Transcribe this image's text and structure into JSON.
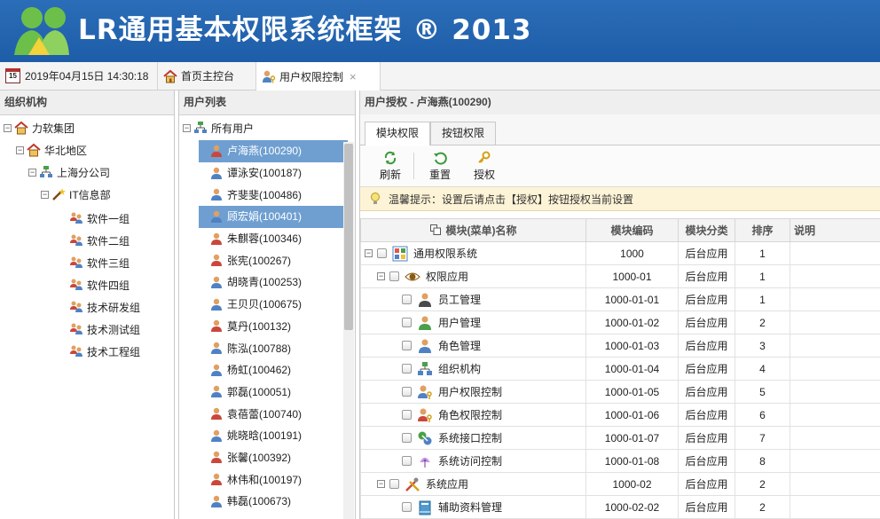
{
  "banner": {
    "title": "LR通用基本权限系统框架 ® 2013"
  },
  "tabbar": {
    "date_label": "2019年04月15日 14:30:18",
    "calendar_day": "15",
    "home_label": "首页主控台",
    "active_label": "用户权限控制",
    "close_glyph": "×"
  },
  "org_panel": {
    "title": "组织机构",
    "nodes": [
      "力软集团",
      "华北地区",
      "上海分公司",
      "IT信息部",
      "软件一组",
      "软件二组",
      "软件三组",
      "软件四组",
      "技术研发组",
      "技术测试组",
      "技术工程组"
    ]
  },
  "user_panel": {
    "title": "用户列表",
    "root": "所有用户",
    "users": [
      "卢海燕(100290)",
      "谭泳安(100187)",
      "齐斐斐(100486)",
      "顾宏娟(100401)",
      "朱麒蓉(100346)",
      "张宪(100267)",
      "胡晓青(100253)",
      "王贝贝(100675)",
      "莫丹(100132)",
      "陈泓(100788)",
      "杨虹(100462)",
      "郭磊(100051)",
      "袁蓓蕾(100740)",
      "姚晓晗(100191)",
      "张馨(100392)",
      "林伟和(100197)",
      "韩磊(100673)"
    ]
  },
  "main_panel": {
    "title": "用户授权 - 卢海燕(100290)",
    "tabs": [
      "模块权限",
      "按钮权限"
    ],
    "toolbar": {
      "refresh": "刷新",
      "reset": "重置",
      "grant": "授权"
    },
    "tip": "温馨提示：设置后请点击【授权】按钮授权当前设置",
    "columns": [
      "模块(菜单)名称",
      "模块编码",
      "模块分类",
      "排序",
      "说明"
    ],
    "rows": [
      {
        "name": "通用权限系统",
        "code": "1000",
        "category": "后台应用",
        "order": "1"
      },
      {
        "name": "权限应用",
        "code": "1000-01",
        "category": "后台应用",
        "order": "1"
      },
      {
        "name": "员工管理",
        "code": "1000-01-01",
        "category": "后台应用",
        "order": "1"
      },
      {
        "name": "用户管理",
        "code": "1000-01-02",
        "category": "后台应用",
        "order": "2"
      },
      {
        "name": "角色管理",
        "code": "1000-01-03",
        "category": "后台应用",
        "order": "3"
      },
      {
        "name": "组织机构",
        "code": "1000-01-04",
        "category": "后台应用",
        "order": "4"
      },
      {
        "name": "用户权限控制",
        "code": "1000-01-05",
        "category": "后台应用",
        "order": "5"
      },
      {
        "name": "角色权限控制",
        "code": "1000-01-06",
        "category": "后台应用",
        "order": "6"
      },
      {
        "name": "系统接口控制",
        "code": "1000-01-07",
        "category": "后台应用",
        "order": "7"
      },
      {
        "name": "系统访问控制",
        "code": "1000-01-08",
        "category": "后台应用",
        "order": "8"
      },
      {
        "name": "系统应用",
        "code": "1000-02",
        "category": "后台应用",
        "order": "2"
      },
      {
        "name": "辅助资料管理",
        "code": "1000-02-02",
        "category": "后台应用",
        "order": "2"
      }
    ]
  }
}
